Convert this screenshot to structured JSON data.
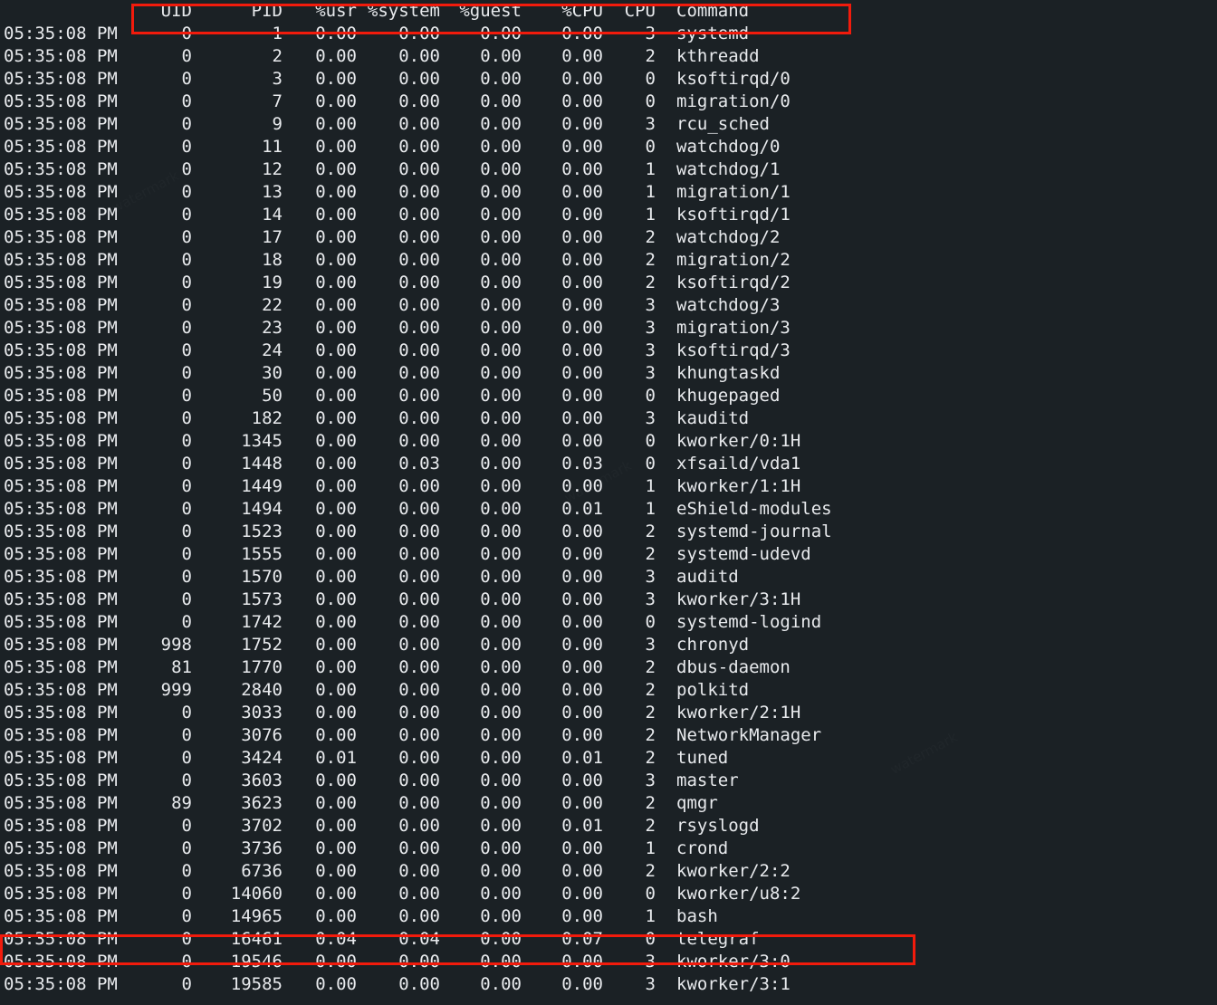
{
  "terminal": {
    "background_color": "#1b2125",
    "text_color": "#e8eaed",
    "highlight_color": "#f21b0c",
    "timestamp": "05:35:08 PM"
  },
  "table": {
    "headers": {
      "time": "",
      "uid": "UID",
      "pid": "PID",
      "usr": "%usr",
      "system": "%system",
      "guest": "%guest",
      "cpu_pct": "%CPU",
      "cpu": "CPU",
      "command": "Command"
    },
    "rows": [
      {
        "time": "05:35:08 PM",
        "uid": "0",
        "pid": "1",
        "usr": "0.00",
        "system": "0.00",
        "guest": "0.00",
        "cpu_pct": "0.00",
        "cpu": "3",
        "command": "systemd"
      },
      {
        "time": "05:35:08 PM",
        "uid": "0",
        "pid": "2",
        "usr": "0.00",
        "system": "0.00",
        "guest": "0.00",
        "cpu_pct": "0.00",
        "cpu": "2",
        "command": "kthreadd"
      },
      {
        "time": "05:35:08 PM",
        "uid": "0",
        "pid": "3",
        "usr": "0.00",
        "system": "0.00",
        "guest": "0.00",
        "cpu_pct": "0.00",
        "cpu": "0",
        "command": "ksoftirqd/0"
      },
      {
        "time": "05:35:08 PM",
        "uid": "0",
        "pid": "7",
        "usr": "0.00",
        "system": "0.00",
        "guest": "0.00",
        "cpu_pct": "0.00",
        "cpu": "0",
        "command": "migration/0"
      },
      {
        "time": "05:35:08 PM",
        "uid": "0",
        "pid": "9",
        "usr": "0.00",
        "system": "0.00",
        "guest": "0.00",
        "cpu_pct": "0.00",
        "cpu": "3",
        "command": "rcu_sched"
      },
      {
        "time": "05:35:08 PM",
        "uid": "0",
        "pid": "11",
        "usr": "0.00",
        "system": "0.00",
        "guest": "0.00",
        "cpu_pct": "0.00",
        "cpu": "0",
        "command": "watchdog/0"
      },
      {
        "time": "05:35:08 PM",
        "uid": "0",
        "pid": "12",
        "usr": "0.00",
        "system": "0.00",
        "guest": "0.00",
        "cpu_pct": "0.00",
        "cpu": "1",
        "command": "watchdog/1"
      },
      {
        "time": "05:35:08 PM",
        "uid": "0",
        "pid": "13",
        "usr": "0.00",
        "system": "0.00",
        "guest": "0.00",
        "cpu_pct": "0.00",
        "cpu": "1",
        "command": "migration/1"
      },
      {
        "time": "05:35:08 PM",
        "uid": "0",
        "pid": "14",
        "usr": "0.00",
        "system": "0.00",
        "guest": "0.00",
        "cpu_pct": "0.00",
        "cpu": "1",
        "command": "ksoftirqd/1"
      },
      {
        "time": "05:35:08 PM",
        "uid": "0",
        "pid": "17",
        "usr": "0.00",
        "system": "0.00",
        "guest": "0.00",
        "cpu_pct": "0.00",
        "cpu": "2",
        "command": "watchdog/2"
      },
      {
        "time": "05:35:08 PM",
        "uid": "0",
        "pid": "18",
        "usr": "0.00",
        "system": "0.00",
        "guest": "0.00",
        "cpu_pct": "0.00",
        "cpu": "2",
        "command": "migration/2"
      },
      {
        "time": "05:35:08 PM",
        "uid": "0",
        "pid": "19",
        "usr": "0.00",
        "system": "0.00",
        "guest": "0.00",
        "cpu_pct": "0.00",
        "cpu": "2",
        "command": "ksoftirqd/2"
      },
      {
        "time": "05:35:08 PM",
        "uid": "0",
        "pid": "22",
        "usr": "0.00",
        "system": "0.00",
        "guest": "0.00",
        "cpu_pct": "0.00",
        "cpu": "3",
        "command": "watchdog/3"
      },
      {
        "time": "05:35:08 PM",
        "uid": "0",
        "pid": "23",
        "usr": "0.00",
        "system": "0.00",
        "guest": "0.00",
        "cpu_pct": "0.00",
        "cpu": "3",
        "command": "migration/3"
      },
      {
        "time": "05:35:08 PM",
        "uid": "0",
        "pid": "24",
        "usr": "0.00",
        "system": "0.00",
        "guest": "0.00",
        "cpu_pct": "0.00",
        "cpu": "3",
        "command": "ksoftirqd/3"
      },
      {
        "time": "05:35:08 PM",
        "uid": "0",
        "pid": "30",
        "usr": "0.00",
        "system": "0.00",
        "guest": "0.00",
        "cpu_pct": "0.00",
        "cpu": "3",
        "command": "khungtaskd"
      },
      {
        "time": "05:35:08 PM",
        "uid": "0",
        "pid": "50",
        "usr": "0.00",
        "system": "0.00",
        "guest": "0.00",
        "cpu_pct": "0.00",
        "cpu": "0",
        "command": "khugepaged"
      },
      {
        "time": "05:35:08 PM",
        "uid": "0",
        "pid": "182",
        "usr": "0.00",
        "system": "0.00",
        "guest": "0.00",
        "cpu_pct": "0.00",
        "cpu": "3",
        "command": "kauditd"
      },
      {
        "time": "05:35:08 PM",
        "uid": "0",
        "pid": "1345",
        "usr": "0.00",
        "system": "0.00",
        "guest": "0.00",
        "cpu_pct": "0.00",
        "cpu": "0",
        "command": "kworker/0:1H"
      },
      {
        "time": "05:35:08 PM",
        "uid": "0",
        "pid": "1448",
        "usr": "0.00",
        "system": "0.03",
        "guest": "0.00",
        "cpu_pct": "0.03",
        "cpu": "0",
        "command": "xfsaild/vda1"
      },
      {
        "time": "05:35:08 PM",
        "uid": "0",
        "pid": "1449",
        "usr": "0.00",
        "system": "0.00",
        "guest": "0.00",
        "cpu_pct": "0.00",
        "cpu": "1",
        "command": "kworker/1:1H"
      },
      {
        "time": "05:35:08 PM",
        "uid": "0",
        "pid": "1494",
        "usr": "0.00",
        "system": "0.00",
        "guest": "0.00",
        "cpu_pct": "0.01",
        "cpu": "1",
        "command": "eShield-modules"
      },
      {
        "time": "05:35:08 PM",
        "uid": "0",
        "pid": "1523",
        "usr": "0.00",
        "system": "0.00",
        "guest": "0.00",
        "cpu_pct": "0.00",
        "cpu": "2",
        "command": "systemd-journal"
      },
      {
        "time": "05:35:08 PM",
        "uid": "0",
        "pid": "1555",
        "usr": "0.00",
        "system": "0.00",
        "guest": "0.00",
        "cpu_pct": "0.00",
        "cpu": "2",
        "command": "systemd-udevd"
      },
      {
        "time": "05:35:08 PM",
        "uid": "0",
        "pid": "1570",
        "usr": "0.00",
        "system": "0.00",
        "guest": "0.00",
        "cpu_pct": "0.00",
        "cpu": "3",
        "command": "auditd"
      },
      {
        "time": "05:35:08 PM",
        "uid": "0",
        "pid": "1573",
        "usr": "0.00",
        "system": "0.00",
        "guest": "0.00",
        "cpu_pct": "0.00",
        "cpu": "3",
        "command": "kworker/3:1H"
      },
      {
        "time": "05:35:08 PM",
        "uid": "0",
        "pid": "1742",
        "usr": "0.00",
        "system": "0.00",
        "guest": "0.00",
        "cpu_pct": "0.00",
        "cpu": "0",
        "command": "systemd-logind"
      },
      {
        "time": "05:35:08 PM",
        "uid": "998",
        "pid": "1752",
        "usr": "0.00",
        "system": "0.00",
        "guest": "0.00",
        "cpu_pct": "0.00",
        "cpu": "3",
        "command": "chronyd"
      },
      {
        "time": "05:35:08 PM",
        "uid": "81",
        "pid": "1770",
        "usr": "0.00",
        "system": "0.00",
        "guest": "0.00",
        "cpu_pct": "0.00",
        "cpu": "2",
        "command": "dbus-daemon"
      },
      {
        "time": "05:35:08 PM",
        "uid": "999",
        "pid": "2840",
        "usr": "0.00",
        "system": "0.00",
        "guest": "0.00",
        "cpu_pct": "0.00",
        "cpu": "2",
        "command": "polkitd"
      },
      {
        "time": "05:35:08 PM",
        "uid": "0",
        "pid": "3033",
        "usr": "0.00",
        "system": "0.00",
        "guest": "0.00",
        "cpu_pct": "0.00",
        "cpu": "2",
        "command": "kworker/2:1H"
      },
      {
        "time": "05:35:08 PM",
        "uid": "0",
        "pid": "3076",
        "usr": "0.00",
        "system": "0.00",
        "guest": "0.00",
        "cpu_pct": "0.00",
        "cpu": "2",
        "command": "NetworkManager"
      },
      {
        "time": "05:35:08 PM",
        "uid": "0",
        "pid": "3424",
        "usr": "0.01",
        "system": "0.00",
        "guest": "0.00",
        "cpu_pct": "0.01",
        "cpu": "2",
        "command": "tuned"
      },
      {
        "time": "05:35:08 PM",
        "uid": "0",
        "pid": "3603",
        "usr": "0.00",
        "system": "0.00",
        "guest": "0.00",
        "cpu_pct": "0.00",
        "cpu": "3",
        "command": "master"
      },
      {
        "time": "05:35:08 PM",
        "uid": "89",
        "pid": "3623",
        "usr": "0.00",
        "system": "0.00",
        "guest": "0.00",
        "cpu_pct": "0.00",
        "cpu": "2",
        "command": "qmgr"
      },
      {
        "time": "05:35:08 PM",
        "uid": "0",
        "pid": "3702",
        "usr": "0.00",
        "system": "0.00",
        "guest": "0.00",
        "cpu_pct": "0.01",
        "cpu": "2",
        "command": "rsyslogd"
      },
      {
        "time": "05:35:08 PM",
        "uid": "0",
        "pid": "3736",
        "usr": "0.00",
        "system": "0.00",
        "guest": "0.00",
        "cpu_pct": "0.00",
        "cpu": "1",
        "command": "crond"
      },
      {
        "time": "05:35:08 PM",
        "uid": "0",
        "pid": "6736",
        "usr": "0.00",
        "system": "0.00",
        "guest": "0.00",
        "cpu_pct": "0.00",
        "cpu": "2",
        "command": "kworker/2:2"
      },
      {
        "time": "05:35:08 PM",
        "uid": "0",
        "pid": "14060",
        "usr": "0.00",
        "system": "0.00",
        "guest": "0.00",
        "cpu_pct": "0.00",
        "cpu": "0",
        "command": "kworker/u8:2"
      },
      {
        "time": "05:35:08 PM",
        "uid": "0",
        "pid": "14965",
        "usr": "0.00",
        "system": "0.00",
        "guest": "0.00",
        "cpu_pct": "0.00",
        "cpu": "1",
        "command": "bash"
      },
      {
        "time": "05:35:08 PM",
        "uid": "0",
        "pid": "16461",
        "usr": "0.04",
        "system": "0.04",
        "guest": "0.00",
        "cpu_pct": "0.07",
        "cpu": "0",
        "command": "telegraf"
      },
      {
        "time": "05:35:08 PM",
        "uid": "0",
        "pid": "19546",
        "usr": "0.00",
        "system": "0.00",
        "guest": "0.00",
        "cpu_pct": "0.00",
        "cpu": "3",
        "command": "kworker/3:0"
      },
      {
        "time": "05:35:08 PM",
        "uid": "0",
        "pid": "19585",
        "usr": "0.00",
        "system": "0.00",
        "guest": "0.00",
        "cpu_pct": "0.00",
        "cpu": "3",
        "command": "kworker/3:1"
      }
    ]
  },
  "annotations": {
    "header_box": "column-header-highlight",
    "telegraf_box": "telegraf-row-highlight"
  }
}
